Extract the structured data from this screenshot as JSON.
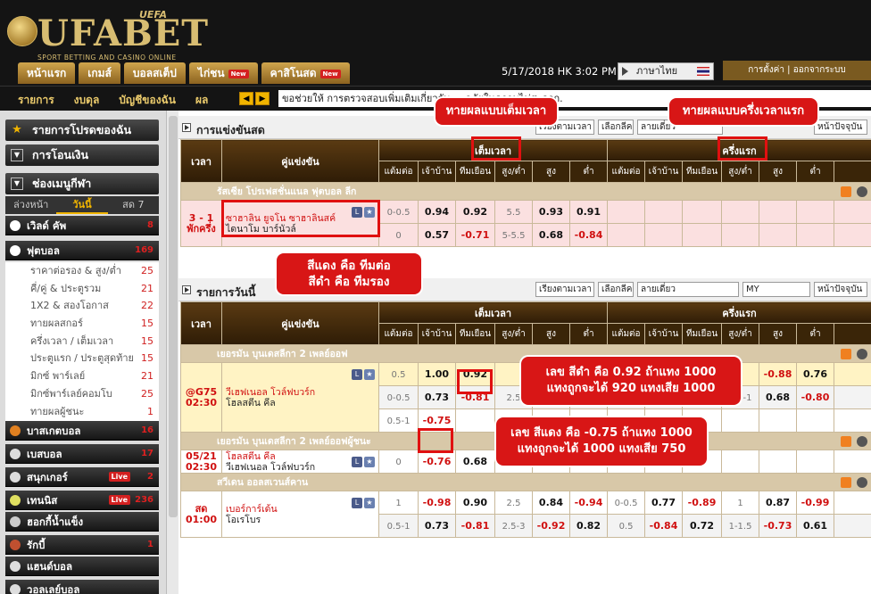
{
  "header": {
    "brand": "UFABET",
    "uefa": "UEFA",
    "tagline": "SPORT BETTING AND CASINO ONLINE",
    "nav": [
      {
        "label": "หน้าแรก",
        "new": false
      },
      {
        "label": "เกมส์",
        "new": false
      },
      {
        "label": "บอลสเต็ป",
        "new": false
      },
      {
        "label": "ไก่ชน",
        "new": true
      },
      {
        "label": "คาสิโนสด",
        "new": true
      }
    ],
    "new_badge": "New",
    "datetime": "5/17/2018 HK 3:02 PM",
    "language": "ภาษาไทย",
    "account": "การตั้งค่า | ออกจากระบบ"
  },
  "subnav": {
    "links": [
      "รายการ",
      "งบดุล",
      "บัญชีของฉัน",
      "ผล"
    ],
    "marquee": "ขอช่วยให้ การตรวจสอบเพิ่มเติมเกี่ยวกับ ...                                     อภัยในความไม่สะดวก."
  },
  "sidebar": {
    "my_bets": "รายการโปรดของฉัน",
    "transfer": "การโอนเงิน",
    "sports_menu": "ช่องเมนูกีฬา",
    "tabs": [
      "ล่วงหน้า",
      "วันนี้",
      "สด 7"
    ],
    "sports": [
      {
        "name": "เวิลด์ คัพ",
        "count": "8",
        "live": false
      },
      {
        "name": "ฟุตบอล",
        "count": "169",
        "live": false
      },
      {
        "name": "บาสเกตบอล",
        "count": "16",
        "live": false
      },
      {
        "name": "เบสบอล",
        "count": "17",
        "live": false
      },
      {
        "name": "สนุกเกอร์",
        "count": "2",
        "live": true
      },
      {
        "name": "เทนนิส",
        "count": "236",
        "live": true
      },
      {
        "name": "ฮอกกี้น้ำแข็ง",
        "count": "",
        "live": false
      },
      {
        "name": "รักบี้",
        "count": "1",
        "live": false
      },
      {
        "name": "แฮนด์บอล",
        "count": "",
        "live": false
      },
      {
        "name": "วอลเลย์บอล",
        "count": "",
        "live": false
      }
    ],
    "live_badge": "Live",
    "football_sub": [
      {
        "label": "ราคาต่อรอง & สูง/ต่ำ",
        "count": "25"
      },
      {
        "label": "คี่/คู่ & ประตูรวม",
        "count": "21"
      },
      {
        "label": "1X2 & สองโอกาส",
        "count": "22"
      },
      {
        "label": "ทายผลสกอร์",
        "count": "15"
      },
      {
        "label": "ครึ่งเวลา / เต็มเวลา",
        "count": "15"
      },
      {
        "label": "ประตูแรก / ประตูสุดท้าย",
        "count": "15"
      },
      {
        "label": "มิกซ์ พาร์เลย์",
        "count": "21"
      },
      {
        "label": "มิกซ์พาร์เลย์คอมโบ",
        "count": "25"
      },
      {
        "label": "ทายผลผู้ชนะ",
        "count": "1"
      }
    ]
  },
  "live_section": {
    "title": "การแข่งขันสด",
    "controls": [
      "เรียงตามเวลา",
      "เลือกลีค",
      "ลายเดี่ยว",
      "หน้าปัจจุบัน"
    ],
    "col_time": "เวลา",
    "col_match": "คู่แข่งขัน",
    "full_time": "เต็มเวลา",
    "half_time": "ครึ่งแรก",
    "sub_cols": [
      "แต้มต่อ",
      "เจ้าบ้าน",
      "ทีมเยือน",
      "สูง/ต่ำ",
      "สูง",
      "ต่ำ"
    ],
    "league": "รัสเซีย โปรเฟสชั่นแนล ฟุตบอล ลีก",
    "rows": [
      {
        "time": "3 - 1",
        "time2": "พักครึ่ง",
        "home": "ซาฮาลิน ยูจโน ซาฮาลินสค์",
        "away": "ไดนาโม บาร์นัวล์",
        "hdp": "0-0.5",
        "h": "0.94",
        "a": "0.92",
        "ou": "5.5",
        "o": "0.93",
        "u": "0.91"
      },
      {
        "hdp": "0",
        "h": "0.57",
        "a": "-0.71",
        "ou": "5-5.5",
        "o": "0.68",
        "u": "-0.84"
      }
    ]
  },
  "today_section": {
    "title": "รายการวันนี้",
    "controls": [
      "เรียงตามเวลา",
      "เลือกลีค",
      "ลายเดี่ยว",
      "MY",
      "หน้าปัจจุบัน"
    ],
    "leagues": [
      {
        "name": "เยอรมัน บุนเดสลีกา 2 เพลย์ออฟ",
        "rows": [
          {
            "time": "@G75",
            "time2": "02:30",
            "home": "วีเฮฟเนอล โวล์ฟบวร์ก",
            "away": "โฮลสตีน คีล",
            "hdp": "0.5",
            "h": "1.00",
            "a": "0.92",
            "ou": "",
            "o": "",
            "u": "",
            "hhdp": "",
            "hh": "",
            "ha": "",
            "hou": "1",
            "ho": "-0.88",
            "hu": "0.76"
          },
          {
            "hdp": "0-0.5",
            "h": "0.73",
            "a": "-0.81",
            "ou": "2.5",
            "o": "-0.82",
            "u": "0.72",
            "hhdp": "0",
            "hh": "0.48",
            "ha": "-0.60",
            "hou": "0.5-1",
            "ho": "0.68",
            "hu": "-0.80"
          },
          {
            "hdp": "0.5-1",
            "h": "-0.75",
            "a": ""
          }
        ]
      },
      {
        "name": "เยอรมัน บุนเดสลีกา 2 เพลย์ออฟผู้ชนะ",
        "rows": [
          {
            "time": "05/21",
            "time2": "02:30",
            "home": "โฮลสตีน คีล",
            "away": "วีเฮฟเนอล โวล์ฟบวร์ก",
            "hdp": "0",
            "h": "-0.76",
            "a": "0.68"
          }
        ]
      },
      {
        "name": "สวีเดน ออลสเวนส์คาน",
        "rows": [
          {
            "time": "สด",
            "time2": "01:00",
            "home": "เบอร์การ์เด้น",
            "away": "โอเรโบร",
            "hdp": "1",
            "h": "-0.98",
            "a": "0.90",
            "ou": "2.5",
            "o": "0.84",
            "u": "-0.94",
            "hhdp": "0-0.5",
            "hh": "0.77",
            "ha": "-0.89",
            "hou": "1",
            "ho": "0.87",
            "hu": "-0.99"
          },
          {
            "hdp": "0.5-1",
            "h": "0.73",
            "a": "-0.81",
            "ou": "2.5-3",
            "o": "-0.92",
            "u": "0.82",
            "hhdp": "0.5",
            "hh": "-0.84",
            "ha": "0.72",
            "hou": "1-1.5",
            "ho": "-0.73",
            "hu": "0.61"
          }
        ]
      }
    ]
  },
  "annotations": {
    "full_time": "ทายผลแบบเต็มเวลา",
    "half_time": "ทายผลแบบครึ่งเวลาแรก",
    "colors": "สีแดง คือ ทีมต่อ\nสีดำ คือ ทีมรอง",
    "black_odds": "เลข สีดำ คือ 0.92 ถ้าแทง 1000\nแทงถูกจะได้ 920 แทงเสีย 1000",
    "red_odds": "เลข สีแดง คือ -0.75 ถ้าแทง 1000\nแทงถูกจะได้ 1000 แทงเสีย 750"
  },
  "colors": {
    "accent": "#d81616",
    "gold": "#d8bd72",
    "header_bg": "#141414"
  }
}
